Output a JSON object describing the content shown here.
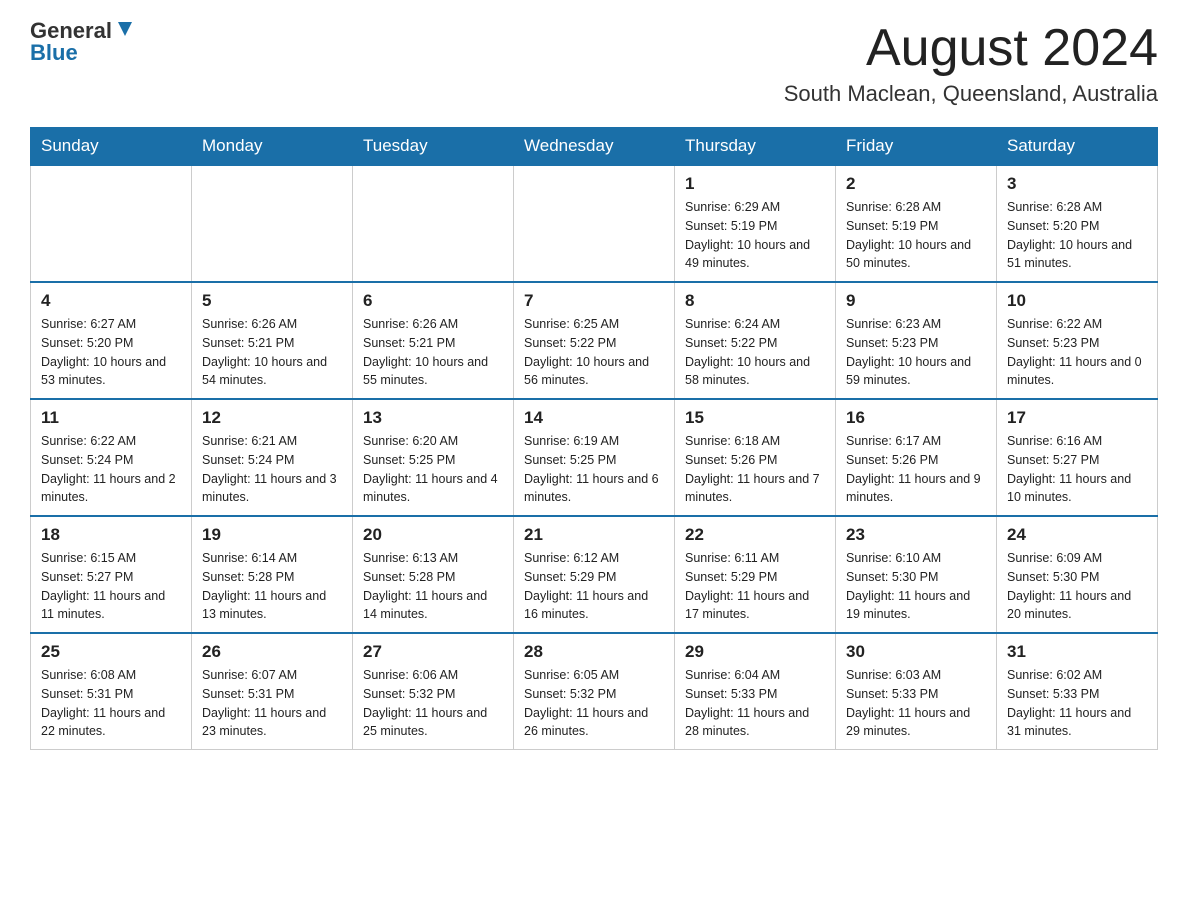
{
  "header": {
    "logo_line1": "General",
    "logo_line2": "Blue",
    "month_year": "August 2024",
    "location": "South Maclean, Queensland, Australia"
  },
  "days_of_week": [
    "Sunday",
    "Monday",
    "Tuesday",
    "Wednesday",
    "Thursday",
    "Friday",
    "Saturday"
  ],
  "weeks": [
    [
      {
        "day": "",
        "info": ""
      },
      {
        "day": "",
        "info": ""
      },
      {
        "day": "",
        "info": ""
      },
      {
        "day": "",
        "info": ""
      },
      {
        "day": "1",
        "info": "Sunrise: 6:29 AM\nSunset: 5:19 PM\nDaylight: 10 hours and 49 minutes."
      },
      {
        "day": "2",
        "info": "Sunrise: 6:28 AM\nSunset: 5:19 PM\nDaylight: 10 hours and 50 minutes."
      },
      {
        "day": "3",
        "info": "Sunrise: 6:28 AM\nSunset: 5:20 PM\nDaylight: 10 hours and 51 minutes."
      }
    ],
    [
      {
        "day": "4",
        "info": "Sunrise: 6:27 AM\nSunset: 5:20 PM\nDaylight: 10 hours and 53 minutes."
      },
      {
        "day": "5",
        "info": "Sunrise: 6:26 AM\nSunset: 5:21 PM\nDaylight: 10 hours and 54 minutes."
      },
      {
        "day": "6",
        "info": "Sunrise: 6:26 AM\nSunset: 5:21 PM\nDaylight: 10 hours and 55 minutes."
      },
      {
        "day": "7",
        "info": "Sunrise: 6:25 AM\nSunset: 5:22 PM\nDaylight: 10 hours and 56 minutes."
      },
      {
        "day": "8",
        "info": "Sunrise: 6:24 AM\nSunset: 5:22 PM\nDaylight: 10 hours and 58 minutes."
      },
      {
        "day": "9",
        "info": "Sunrise: 6:23 AM\nSunset: 5:23 PM\nDaylight: 10 hours and 59 minutes."
      },
      {
        "day": "10",
        "info": "Sunrise: 6:22 AM\nSunset: 5:23 PM\nDaylight: 11 hours and 0 minutes."
      }
    ],
    [
      {
        "day": "11",
        "info": "Sunrise: 6:22 AM\nSunset: 5:24 PM\nDaylight: 11 hours and 2 minutes."
      },
      {
        "day": "12",
        "info": "Sunrise: 6:21 AM\nSunset: 5:24 PM\nDaylight: 11 hours and 3 minutes."
      },
      {
        "day": "13",
        "info": "Sunrise: 6:20 AM\nSunset: 5:25 PM\nDaylight: 11 hours and 4 minutes."
      },
      {
        "day": "14",
        "info": "Sunrise: 6:19 AM\nSunset: 5:25 PM\nDaylight: 11 hours and 6 minutes."
      },
      {
        "day": "15",
        "info": "Sunrise: 6:18 AM\nSunset: 5:26 PM\nDaylight: 11 hours and 7 minutes."
      },
      {
        "day": "16",
        "info": "Sunrise: 6:17 AM\nSunset: 5:26 PM\nDaylight: 11 hours and 9 minutes."
      },
      {
        "day": "17",
        "info": "Sunrise: 6:16 AM\nSunset: 5:27 PM\nDaylight: 11 hours and 10 minutes."
      }
    ],
    [
      {
        "day": "18",
        "info": "Sunrise: 6:15 AM\nSunset: 5:27 PM\nDaylight: 11 hours and 11 minutes."
      },
      {
        "day": "19",
        "info": "Sunrise: 6:14 AM\nSunset: 5:28 PM\nDaylight: 11 hours and 13 minutes."
      },
      {
        "day": "20",
        "info": "Sunrise: 6:13 AM\nSunset: 5:28 PM\nDaylight: 11 hours and 14 minutes."
      },
      {
        "day": "21",
        "info": "Sunrise: 6:12 AM\nSunset: 5:29 PM\nDaylight: 11 hours and 16 minutes."
      },
      {
        "day": "22",
        "info": "Sunrise: 6:11 AM\nSunset: 5:29 PM\nDaylight: 11 hours and 17 minutes."
      },
      {
        "day": "23",
        "info": "Sunrise: 6:10 AM\nSunset: 5:30 PM\nDaylight: 11 hours and 19 minutes."
      },
      {
        "day": "24",
        "info": "Sunrise: 6:09 AM\nSunset: 5:30 PM\nDaylight: 11 hours and 20 minutes."
      }
    ],
    [
      {
        "day": "25",
        "info": "Sunrise: 6:08 AM\nSunset: 5:31 PM\nDaylight: 11 hours and 22 minutes."
      },
      {
        "day": "26",
        "info": "Sunrise: 6:07 AM\nSunset: 5:31 PM\nDaylight: 11 hours and 23 minutes."
      },
      {
        "day": "27",
        "info": "Sunrise: 6:06 AM\nSunset: 5:32 PM\nDaylight: 11 hours and 25 minutes."
      },
      {
        "day": "28",
        "info": "Sunrise: 6:05 AM\nSunset: 5:32 PM\nDaylight: 11 hours and 26 minutes."
      },
      {
        "day": "29",
        "info": "Sunrise: 6:04 AM\nSunset: 5:33 PM\nDaylight: 11 hours and 28 minutes."
      },
      {
        "day": "30",
        "info": "Sunrise: 6:03 AM\nSunset: 5:33 PM\nDaylight: 11 hours and 29 minutes."
      },
      {
        "day": "31",
        "info": "Sunrise: 6:02 AM\nSunset: 5:33 PM\nDaylight: 11 hours and 31 minutes."
      }
    ]
  ]
}
